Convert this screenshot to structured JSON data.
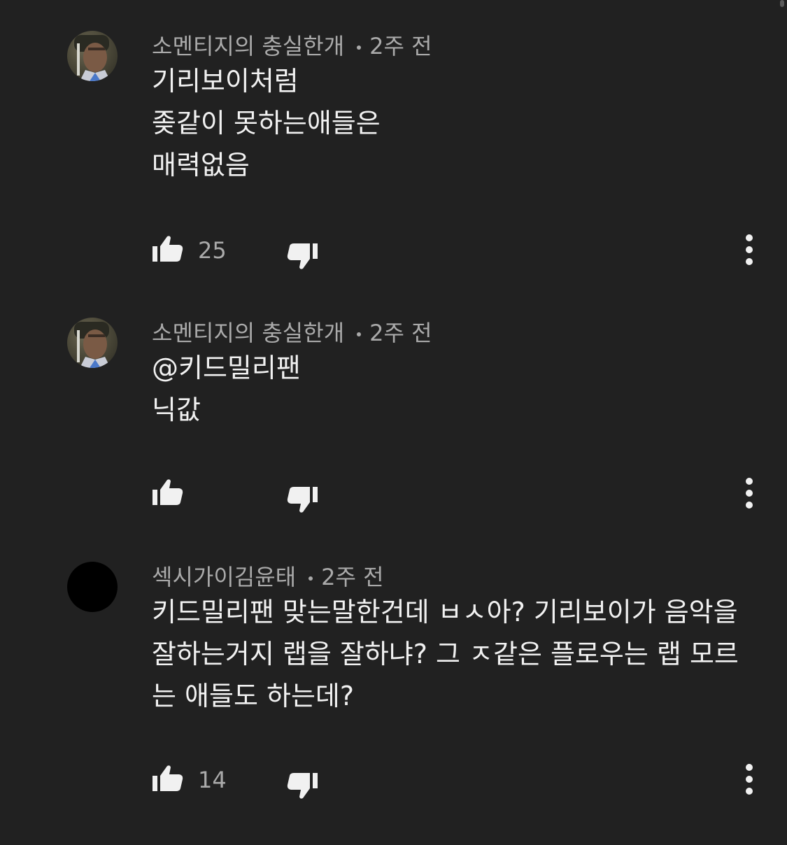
{
  "colors": {
    "background": "#212121",
    "text_primary": "#f1f1f1",
    "text_secondary": "#aaaaaa"
  },
  "comments": [
    {
      "author": "소멘티지의 충실한개",
      "time": "2주 전",
      "text": "기리보이처럼\n좆같이 못하는애들은\n매력없음",
      "likes": "25",
      "avatar": "photo-avatar"
    },
    {
      "author": "소멘티지의 충실한개",
      "time": "2주 전",
      "text": "@키드밀리팬\n닉값",
      "likes": "",
      "avatar": "photo-avatar"
    },
    {
      "author": "섹시가이김윤태",
      "time": "2주 전",
      "text": "키드밀리팬 맞는말한건데 ㅂㅅ아? 기리보이가 음악을\n잘하는거지 랩을 잘하냐? 그 ㅈ같은 플로우는 랩 모르\n는 애들도 하는데?",
      "likes": "14",
      "avatar": "black-avatar"
    }
  ],
  "icons": {
    "like": "thumbs-up-icon",
    "dislike": "thumbs-down-icon",
    "more": "more-vert-icon"
  }
}
